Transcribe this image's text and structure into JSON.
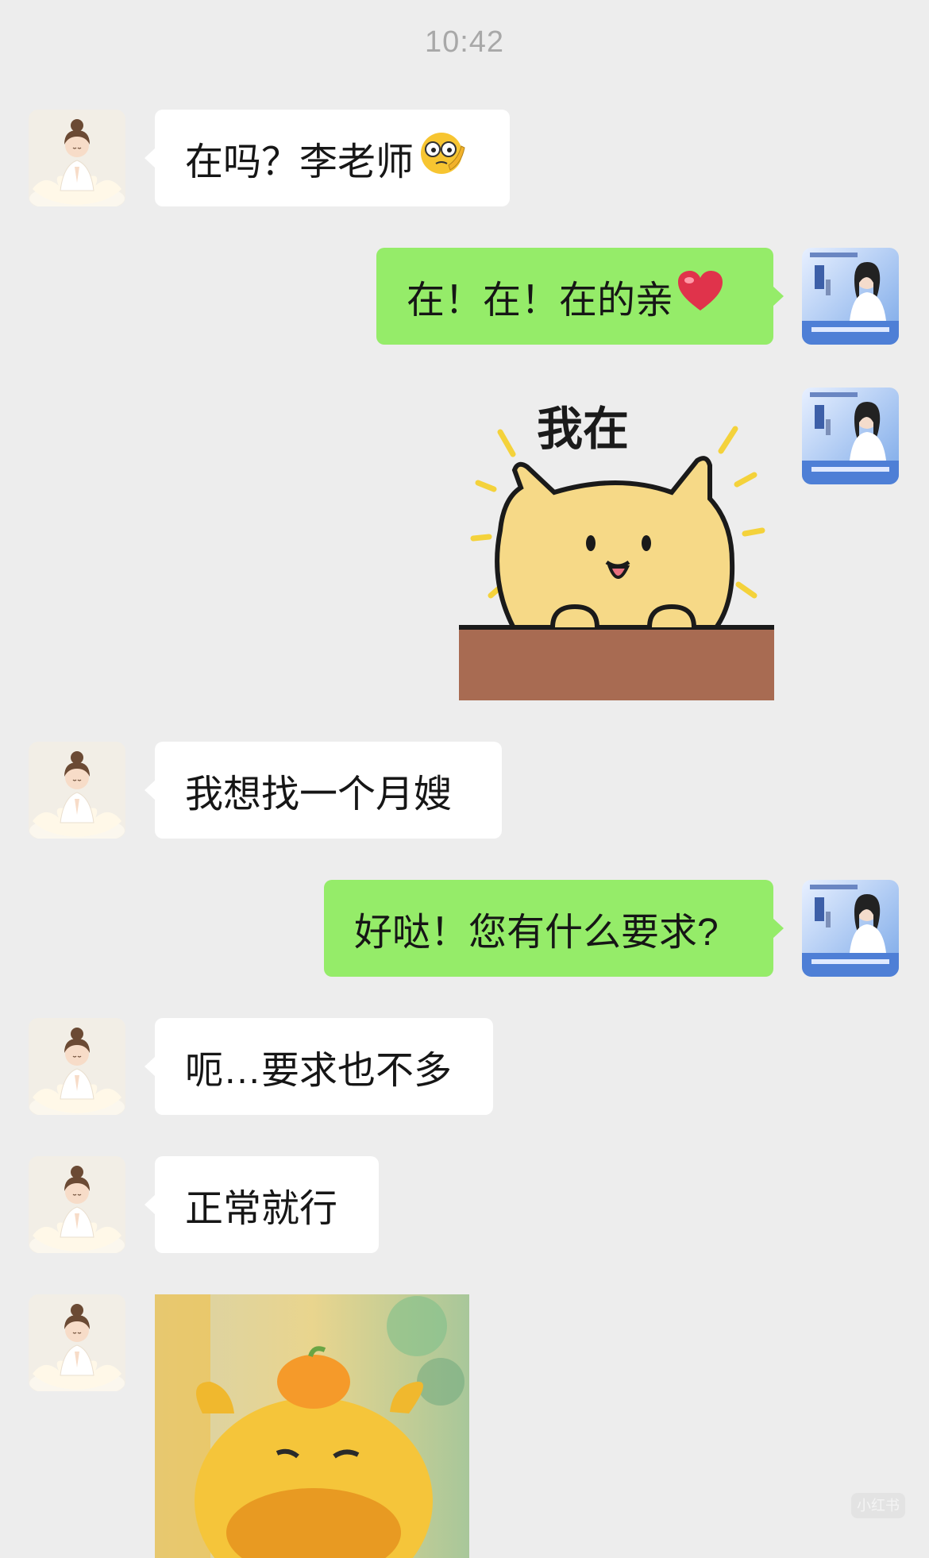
{
  "header": {
    "time": "10:42"
  },
  "messages": {
    "m1": {
      "text": "在吗？李老师"
    },
    "m2": {
      "text": "在！在！在的亲"
    },
    "m3": {
      "text": "我在"
    },
    "m4": {
      "text": "我想找一个月嫂"
    },
    "m5": {
      "text": "好哒！您有什么要求?"
    },
    "m6": {
      "text": "呃…要求也不多"
    },
    "m7": {
      "text": "正常就行"
    }
  },
  "watermark": {
    "badge": "小红书"
  },
  "colors": {
    "background": "#ededed",
    "incoming": "#ffffff",
    "outgoing": "#95ec69",
    "timestamp": "#a8a8a8"
  }
}
